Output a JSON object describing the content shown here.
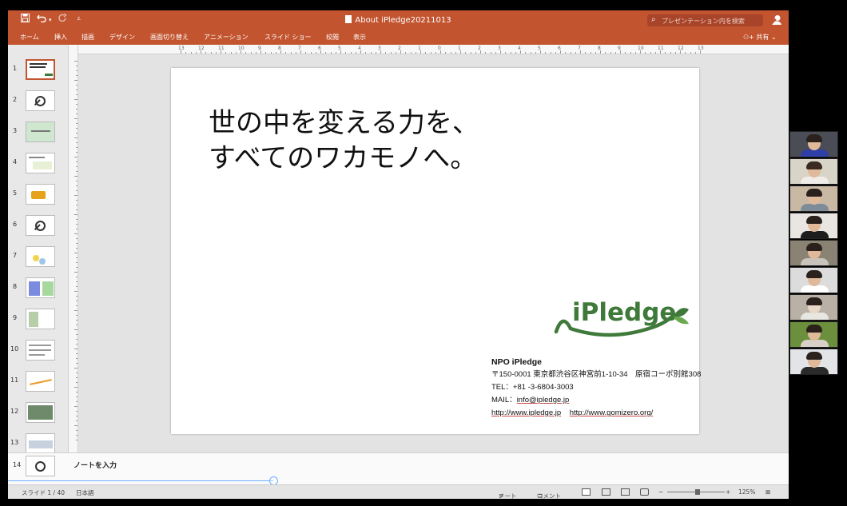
{
  "window": {
    "doc_title": "About iPledge20211013",
    "search_placeholder": "プレゼンテーション内を検索",
    "accent": "#c2542f"
  },
  "ribbon": {
    "tabs": [
      "ホーム",
      "挿入",
      "描画",
      "デザイン",
      "画面切り替え",
      "アニメーション",
      "スライド ショー",
      "校閲",
      "表示"
    ],
    "share_label": "共有"
  },
  "ruler": {
    "numbers": [
      "13",
      "12",
      "11",
      "10",
      "9",
      "8",
      "7",
      "6",
      "5",
      "4",
      "3",
      "2",
      "1",
      "0",
      "1",
      "2",
      "3",
      "4",
      "5",
      "6",
      "7",
      "8",
      "9",
      "10",
      "11",
      "12",
      "13"
    ]
  },
  "thumbnails": [
    "1",
    "2",
    "3",
    "4",
    "5",
    "6",
    "7",
    "8",
    "9",
    "10",
    "11",
    "12",
    "13"
  ],
  "slide": {
    "headline_line1": "世の中を変える力を、",
    "headline_line2": "すべてのワカモノへ。",
    "logo_text": "iPledge",
    "org": "NPO iPledge",
    "address": "〒150-0001 東京都渋谷区神宮前1-10-34　原宿コーポ別館308",
    "tel": "TEL：+81 -3-6804-3003",
    "mail_prefix": "MAIL：",
    "mail": "info@ipledge.jp",
    "url1": "http://www.ipledge.jp",
    "url2": "http://www.gomizero.org/"
  },
  "notes": {
    "placeholder": "ノートを入力",
    "thumb_number": "14"
  },
  "status": {
    "slide_position": "スライド 1 / 40",
    "language": "日本語",
    "notes_label": "ノート",
    "comments_label": "コメント",
    "zoom": "125%"
  }
}
